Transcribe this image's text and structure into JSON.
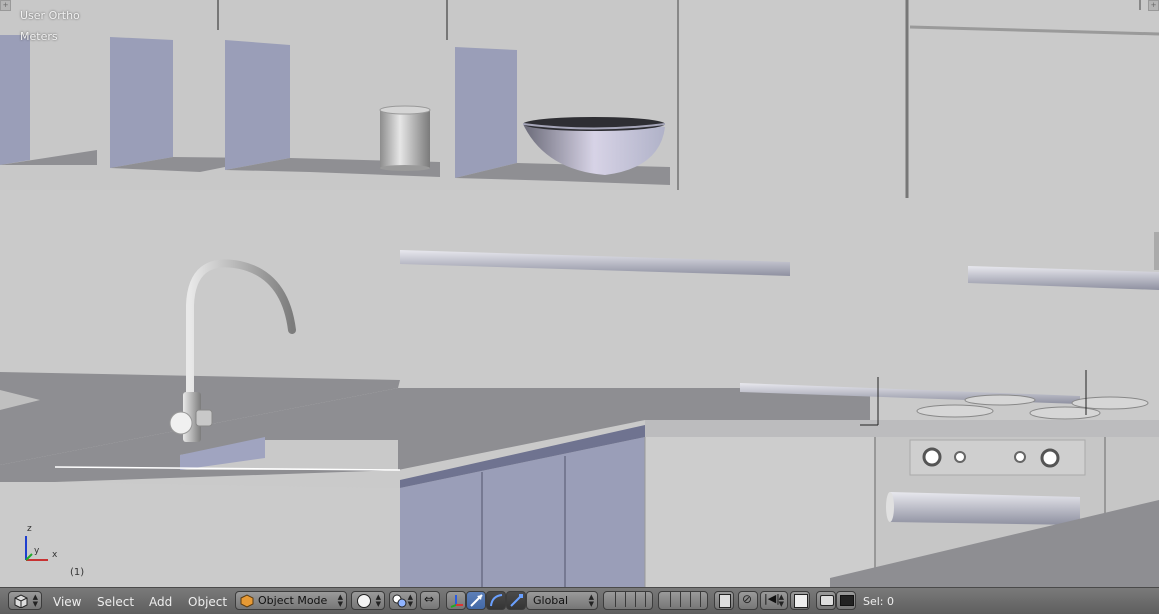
{
  "viewport": {
    "view_name": "User Ortho",
    "units": "Meters",
    "frame_number": "(1)",
    "axes": {
      "z": "z",
      "y": "y",
      "x": "x"
    }
  },
  "header": {
    "editor_type_icon": "3d-view-icon",
    "menus": [
      "View",
      "Select",
      "Add",
      "Object"
    ],
    "mode": "Object Mode",
    "mode_icon": "cube-icon",
    "shading_icon": "solid-sphere-icon",
    "pivot_icon": "pivot-icon",
    "transform_orientation": "Global",
    "selection_count": "Sel: 0"
  },
  "colors": {
    "viewport_bg": "#c9c9c9",
    "object_face": "#9a9eb8",
    "header_bg": "#6b6b6b",
    "active_blue": "#5477b1"
  }
}
